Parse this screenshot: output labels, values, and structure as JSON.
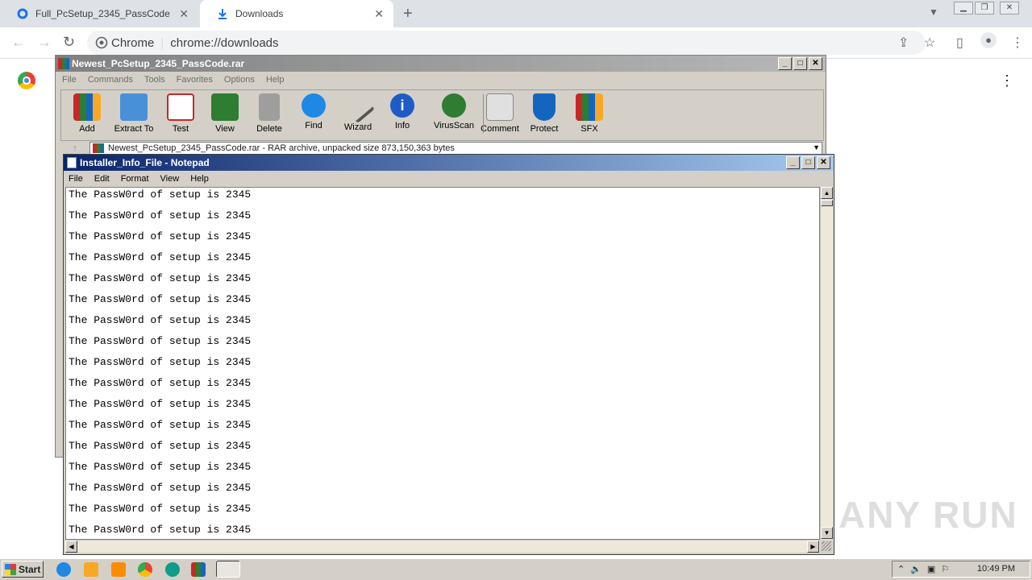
{
  "chrome": {
    "tabs": [
      {
        "title": "Full_PcSetup_2345_PassCode",
        "active": false
      },
      {
        "title": "Downloads",
        "active": true
      }
    ],
    "new_tab": "+",
    "site_label": "Chrome",
    "url": "chrome://downloads",
    "accent": "#1a73e8"
  },
  "winrar": {
    "title": "Newest_PcSetup_2345_PassCode.rar",
    "menu": [
      "File",
      "Commands",
      "Tools",
      "Favorites",
      "Options",
      "Help"
    ],
    "tools": [
      "Add",
      "Extract To",
      "Test",
      "View",
      "Delete",
      "Find",
      "Wizard",
      "Info",
      "VirusScan",
      "Comment",
      "Protect",
      "SFX"
    ],
    "path": "Newest_PcSetup_2345_PassCode.rar - RAR archive, unpacked size 873,150,363 bytes"
  },
  "notepad": {
    "title": "Installer_Info_File - Notepad",
    "menu": [
      "File",
      "Edit",
      "Format",
      "View",
      "Help"
    ],
    "lines": [
      "The PassW0rd of setup is 2345",
      "The PassW0rd of setup is 2345",
      "The PassW0rd of setup is 2345",
      "The PassW0rd of setup is 2345",
      "The PassW0rd of setup is 2345",
      "The PassW0rd of setup is 2345",
      "The PassW0rd of setup is 2345",
      "The PassW0rd of setup is 2345",
      "The PassW0rd of setup is 2345",
      "The PassW0rd of setup is 2345",
      "The PassW0rd of setup is 2345",
      "The PassW0rd of setup is 2345",
      "The PassW0rd of setup is 2345",
      "The PassW0rd of setup is 2345",
      "The PassW0rd of setup is 2345",
      "The PassW0rd of setup is 2345",
      "The PassW0rd of setup is 2345"
    ]
  },
  "watermark": "ANY RUN",
  "taskbar": {
    "start_label": "Start",
    "clock": "10:49 PM"
  }
}
